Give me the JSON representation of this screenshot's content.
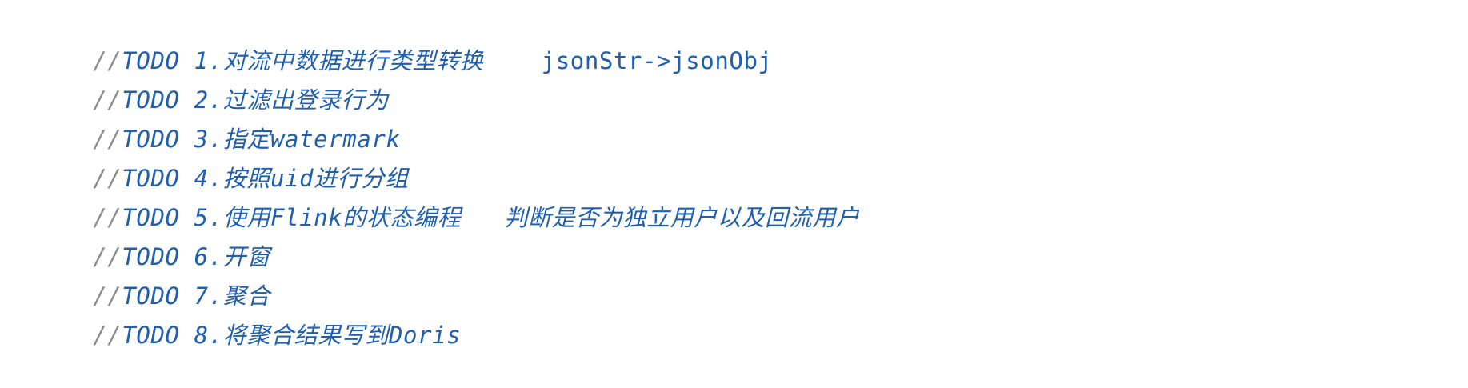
{
  "editor": {
    "comment_prefix": "//",
    "lines": [
      {
        "text": "TODO 1.对流中数据进行类型转换",
        "code": "jsonStr->jsonObj"
      },
      {
        "text": "TODO 2.过滤出登录行为",
        "code": ""
      },
      {
        "text": "TODO 3.指定watermark",
        "code": ""
      },
      {
        "text": "TODO 4.按照uid进行分组",
        "code": ""
      },
      {
        "text": "TODO 5.使用Flink的状态编程   判断是否为独立用户以及回流用户",
        "code": ""
      },
      {
        "text": "TODO 6.开窗",
        "code": ""
      },
      {
        "text": "TODO 7.聚合",
        "code": ""
      },
      {
        "text": "TODO 8.将聚合结果写到Doris",
        "code": ""
      }
    ]
  },
  "colors": {
    "comment_slashes": "#8c8c8c",
    "todo_text": "#1f5fb0",
    "background": "#ffffff"
  }
}
